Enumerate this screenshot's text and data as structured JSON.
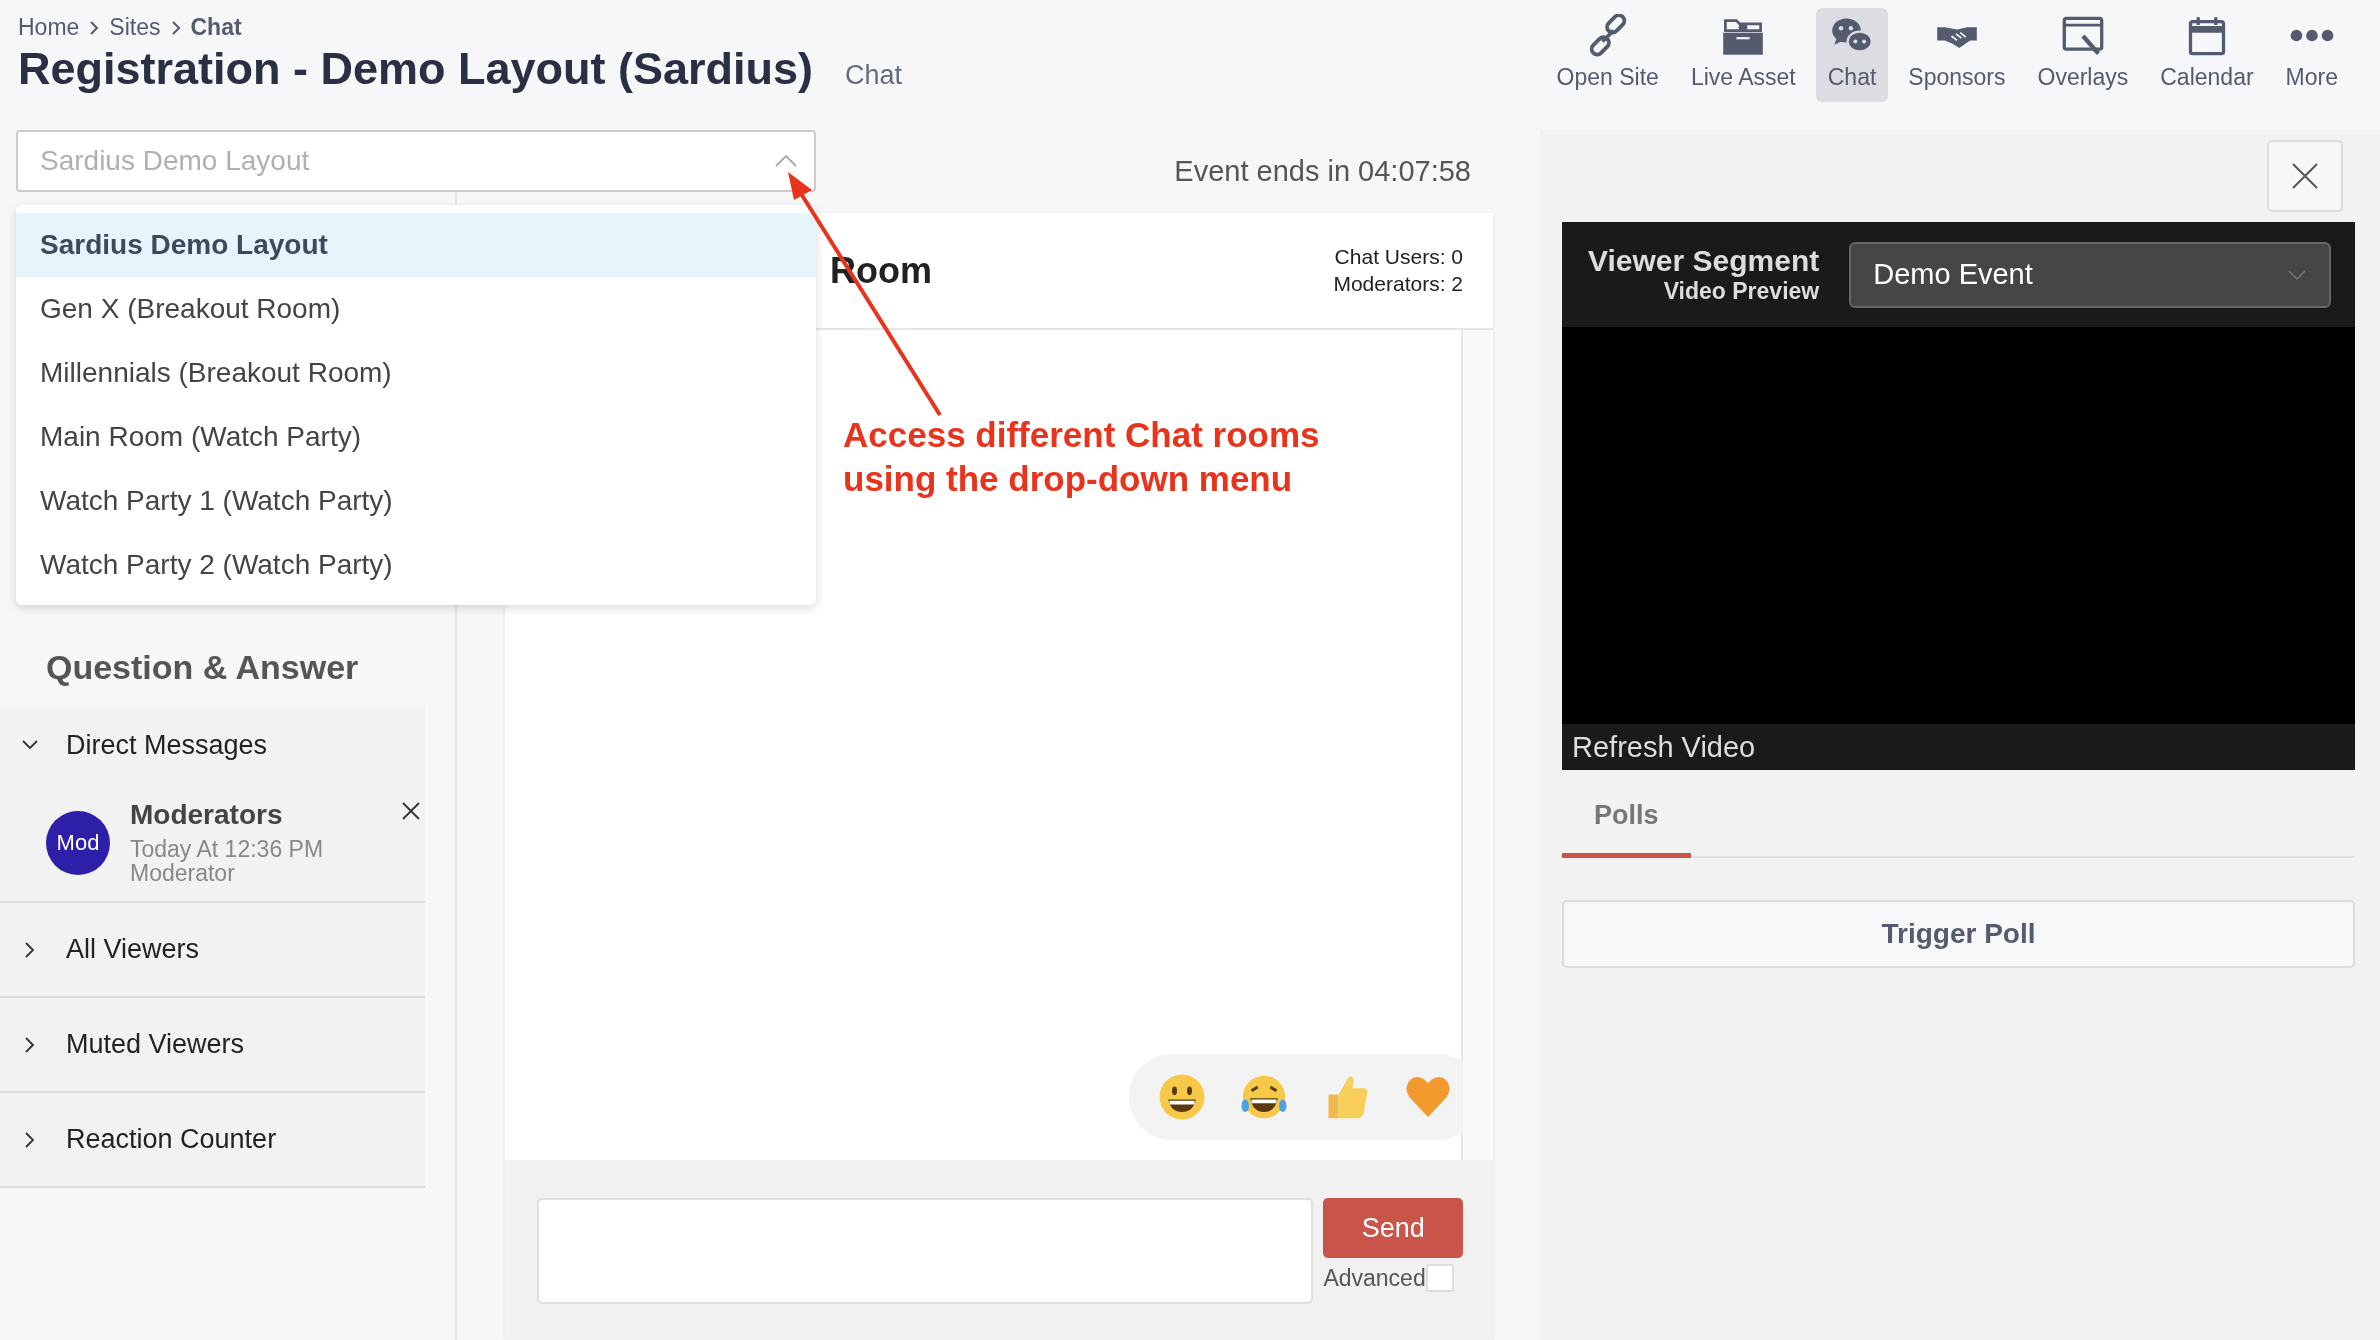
{
  "breadcrumb": [
    {
      "label": "Home",
      "current": false
    },
    {
      "label": "Sites",
      "current": false
    },
    {
      "label": "Chat",
      "current": true
    }
  ],
  "page": {
    "title": "Registration - Demo Layout (Sardius)",
    "subtitle": "Chat"
  },
  "toolbar": [
    {
      "label": "Open Site",
      "kind": "link",
      "selected": false
    },
    {
      "label": "Live Asset",
      "kind": "folder",
      "selected": false
    },
    {
      "label": "Chat",
      "kind": "chat",
      "selected": true
    },
    {
      "label": "Sponsors",
      "kind": "handshake",
      "selected": false
    },
    {
      "label": "Overlays",
      "kind": "overlay",
      "selected": false
    },
    {
      "label": "Calendar",
      "kind": "calendar",
      "selected": false
    },
    {
      "label": "More",
      "kind": "more",
      "selected": false
    }
  ],
  "room_select": {
    "placeholder": "Sardius Demo Layout",
    "expanded": true,
    "options": [
      {
        "label": "Sardius Demo Layout",
        "selected": true
      },
      {
        "label": "Gen X (Breakout Room)",
        "selected": false
      },
      {
        "label": "Millennials (Breakout Room)",
        "selected": false
      },
      {
        "label": "Main Room (Watch Party)",
        "selected": false
      },
      {
        "label": "Watch Party 1 (Watch Party)",
        "selected": false
      },
      {
        "label": "Watch Party 2 (Watch Party)",
        "selected": false
      }
    ]
  },
  "sidebar": {
    "heading": "Question & Answer",
    "sections": [
      {
        "label": "Direct Messages",
        "expanded": true,
        "items": [
          {
            "avatar": "Mod",
            "name": "Moderators",
            "time": "Today At 12:36 PM",
            "role": "Moderator"
          }
        ]
      },
      {
        "label": "All Viewers",
        "expanded": false
      },
      {
        "label": "Muted Viewers",
        "expanded": false
      },
      {
        "label": "Reaction Counter",
        "expanded": false
      }
    ]
  },
  "event_timer": "Event ends in 04:07:58",
  "chat": {
    "title": "Room",
    "users": "Chat Users: 0",
    "moderators": "Moderators: 2",
    "reactions": [
      {
        "kind": "grin"
      },
      {
        "kind": "laugh"
      },
      {
        "kind": "thumbs_up"
      },
      {
        "kind": "heart"
      }
    ],
    "send": "Send",
    "advanced_label": "Advanced",
    "advanced_checked": false
  },
  "annotation": {
    "lines": [
      "Access different Chat rooms",
      "using the drop-down menu"
    ]
  },
  "video": {
    "label": "Viewer Segment",
    "sublabel": "Video Preview",
    "segment": "Demo Event",
    "refresh": "Refresh Video"
  },
  "tabs": [
    {
      "label": "Polls",
      "selected": true
    }
  ],
  "poll_button": "Trigger Poll"
}
